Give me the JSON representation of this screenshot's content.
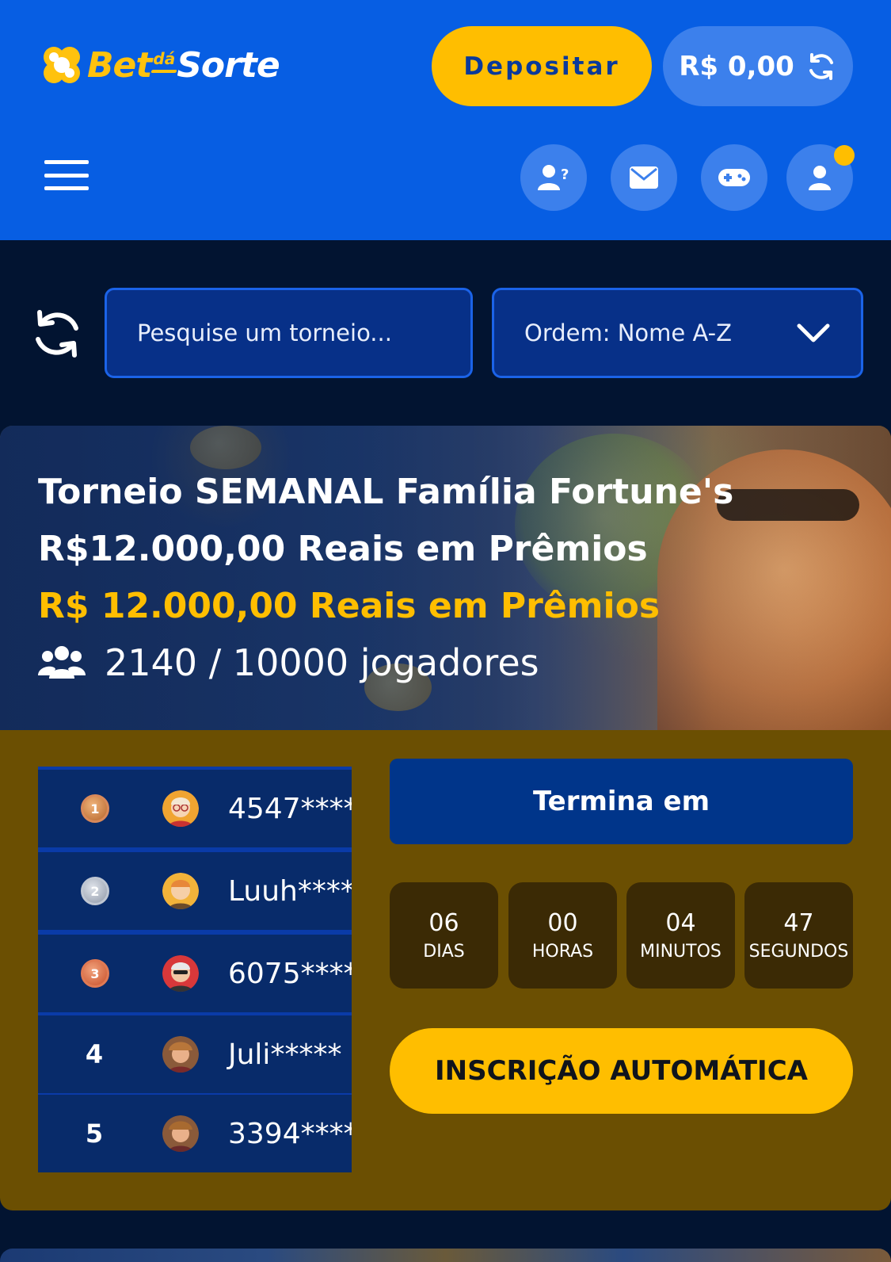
{
  "header": {
    "logo": {
      "part1": "Bet",
      "part2": "dá",
      "part3": "Sorte"
    },
    "deposit_label": "Depositar",
    "balance": "R$ 0,00",
    "icons": [
      "support-icon",
      "mail-icon",
      "gamepad-icon",
      "user-icon"
    ],
    "has_notification": true
  },
  "filters": {
    "search_placeholder": "Pesquise um torneio...",
    "sort_label": "Ordem: Nome A-Z"
  },
  "tournament": {
    "title": "Torneio SEMANAL Família Fortune's R$12.000,00 Reais em Prêmios",
    "prize": "R$ 12.000,00 Reais em Prêmios",
    "players": "2140 / 10000 jogadores",
    "leaderboard": [
      {
        "rank": "1",
        "medal": "gold",
        "name": "4547****"
      },
      {
        "rank": "2",
        "medal": "silver",
        "name": "Luuh****"
      },
      {
        "rank": "3",
        "medal": "bronze",
        "name": "6075****"
      },
      {
        "rank": "4",
        "medal": "",
        "name": "Juli*****"
      },
      {
        "rank": "5",
        "medal": "",
        "name": "3394****"
      }
    ],
    "ends_in_label": "Termina em",
    "countdown": [
      {
        "value": "06",
        "label": "DIAS"
      },
      {
        "value": "00",
        "label": "HORAS"
      },
      {
        "value": "04",
        "label": "MINUTOS"
      },
      {
        "value": "47",
        "label": "SEGUNDOS"
      }
    ],
    "auto_signup_label": "INSCRIÇÃO AUTOMÁTICA"
  },
  "colors": {
    "header_bg": "#075ee3",
    "accent_yellow": "#ffbe00",
    "page_bg": "#021431",
    "card_bg": "#6b4f02"
  }
}
